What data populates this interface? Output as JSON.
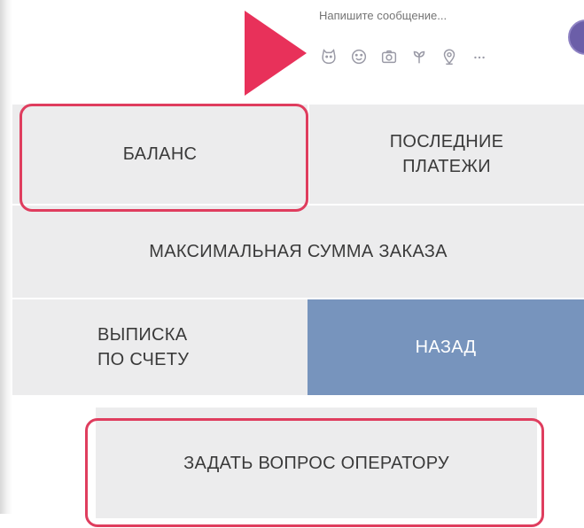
{
  "composer": {
    "placeholder": "Напишите сообщение...",
    "icons": [
      "sticker-icon",
      "emoji-icon",
      "camera-icon",
      "doodle-icon",
      "location-icon",
      "more-icon"
    ]
  },
  "keyboard": {
    "balance": "БАЛАНС",
    "last_payments": "ПОСЛЕДНИЕ\nПЛАТЕЖИ",
    "max_order": "МАКСИМАЛЬНАЯ СУММА ЗАКАЗА",
    "statement": "ВЫПИСКА\nПО СЧЕТУ",
    "back": "НАЗАД",
    "ask_operator": "ЗАДАТЬ ВОПРОС ОПЕРАТОРУ"
  },
  "colors": {
    "accent_highlight": "#df3d5e",
    "arrow": "#e8315a",
    "back_button": "#7794bd",
    "button_bg": "#ececed",
    "avatar": "#6b5ea8"
  }
}
